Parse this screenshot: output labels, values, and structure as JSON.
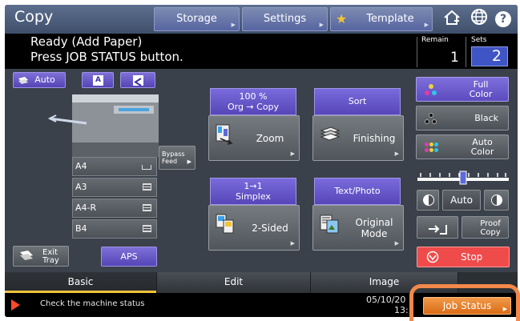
{
  "header": {
    "title": "Copy",
    "buttons": [
      {
        "label": "Storage"
      },
      {
        "label": "Settings"
      },
      {
        "label": "Template"
      }
    ],
    "icons": [
      "star-icon",
      "home-icon",
      "globe-icon",
      "help-icon"
    ],
    "help_glyph": "?"
  },
  "status": {
    "line1": "Ready (Add Paper)",
    "line2": "Press JOB STATUS button.",
    "remain_label": "Remain",
    "remain_value": "1",
    "sets_label": "Sets",
    "sets_value": "2"
  },
  "left_panel": {
    "auto_label": "Auto",
    "orientation_a_label": "A",
    "bypass_label": "Bypass Feed",
    "paper_trays": [
      {
        "label": "A4"
      },
      {
        "label": "A3"
      },
      {
        "label": "A4-R"
      },
      {
        "label": "B4"
      }
    ],
    "exit_tray_label": "Exit Tray",
    "aps_label": "APS"
  },
  "functions": {
    "zoom": {
      "top_line1": "100 %",
      "top_line2": "Org  →  Copy",
      "label": "Zoom"
    },
    "finishing": {
      "top": "Sort",
      "label": "Finishing"
    },
    "two_sided": {
      "top_line1": "1→1",
      "top_line2": "Simplex",
      "label": "2-Sided"
    },
    "original_mode": {
      "top": "Text/Photo",
      "label_line1": "Original",
      "label_line2": "Mode"
    }
  },
  "color_panel": {
    "full_color": "Full Color",
    "black": "Black",
    "auto_color": "Auto Color",
    "density_level": 0.5,
    "density_auto": "Auto",
    "proof_copy": "Proof Copy",
    "stop": "Stop",
    "stop_color": "#ef4b4b"
  },
  "tabs": [
    {
      "label": "Basic",
      "active": true
    },
    {
      "label": "Edit",
      "active": false
    },
    {
      "label": "Image",
      "active": false
    }
  ],
  "bottom": {
    "message": "Check the machine status",
    "date": "05/10/20",
    "time": "13:",
    "job_status_label": "Job Status",
    "accent_color": "#e07a22"
  }
}
